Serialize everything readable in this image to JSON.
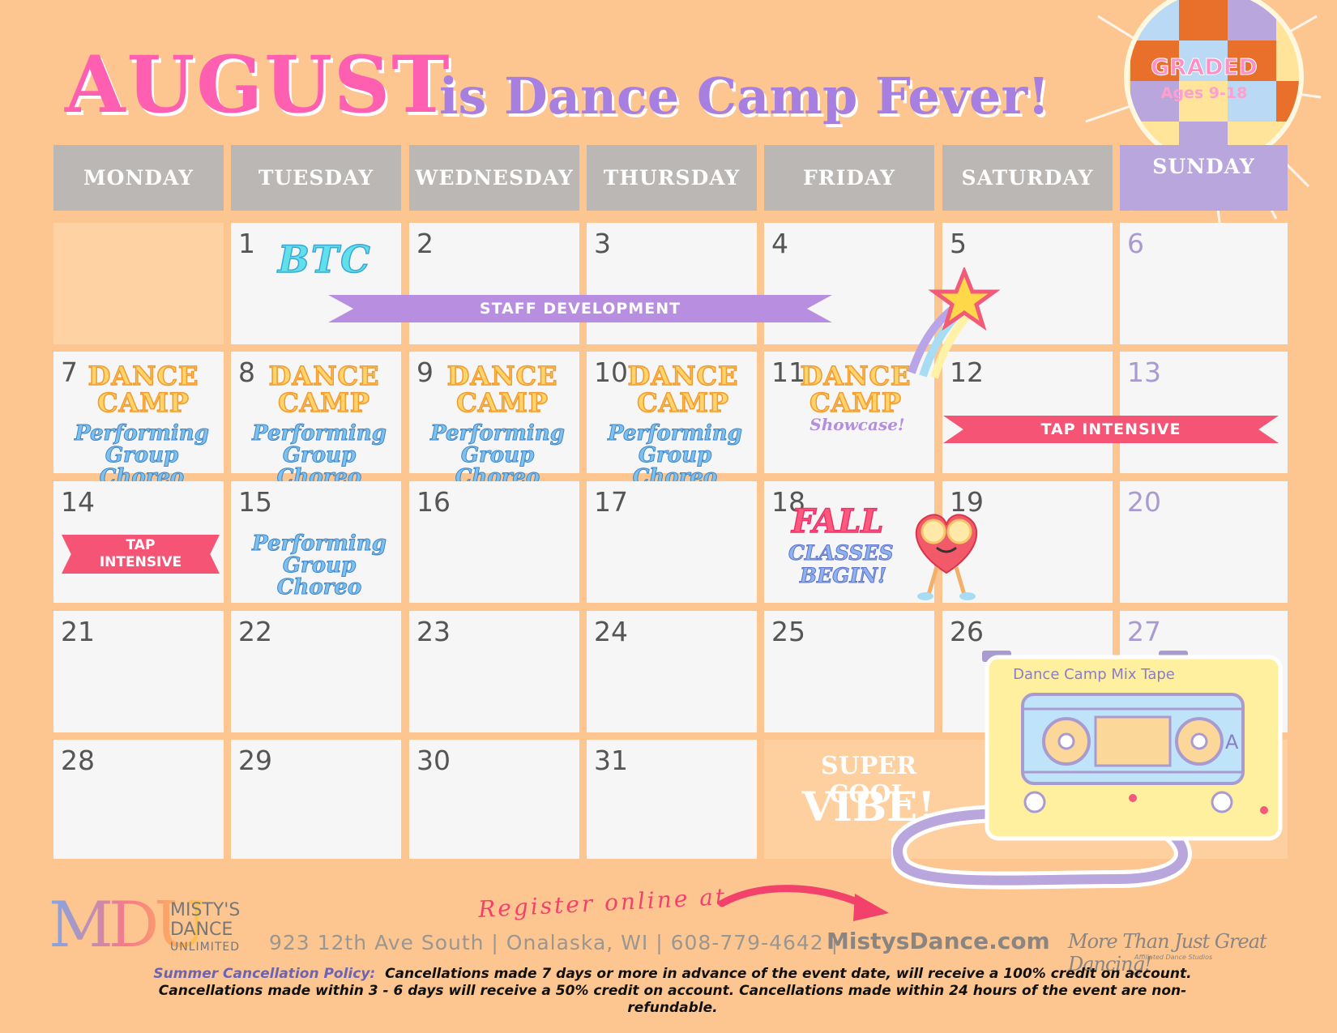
{
  "header": {
    "month": "AUGUST",
    "subtitle": "is Dance Camp Fever!",
    "badge_title": "GRADED",
    "badge_ages": "Ages 9-18"
  },
  "days": [
    "MONDAY",
    "TUESDAY",
    "WEDNESDAY",
    "THURSDAY",
    "FRIDAY",
    "SATURDAY",
    "SUNDAY"
  ],
  "dates": {
    "d1": "1",
    "d2": "2",
    "d3": "3",
    "d4": "4",
    "d5": "5",
    "d6": "6",
    "d7": "7",
    "d8": "8",
    "d9": "9",
    "d10": "10",
    "d11": "11",
    "d12": "12",
    "d13": "13",
    "d14": "14",
    "d15": "15",
    "d16": "16",
    "d17": "17",
    "d18": "18",
    "d19": "19",
    "d20": "20",
    "d21": "21",
    "d22": "22",
    "d23": "23",
    "d24": "24",
    "d25": "25",
    "d26": "26",
    "d27": "27",
    "d28": "28",
    "d29": "29",
    "d30": "30",
    "d31": "31"
  },
  "events": {
    "btc": "BTC",
    "staff_development": "STAFF DEVELOPMENT",
    "dance": "DANCE",
    "camp": "CAMP",
    "performing": "Performing",
    "group_choreo": "Group Choreo",
    "showcase": "Showcase!",
    "tap_intensive": "TAP INTENSIVE",
    "tap": "TAP",
    "intensive": "INTENSIVE",
    "fall": "FALL",
    "classes": "CLASSES",
    "begin": "BEGIN!",
    "super_cool": "SUPER COOL",
    "vibe": "VIBE!",
    "mix_tape": "Dance Camp Mix Tape",
    "tape_side": "A"
  },
  "footer": {
    "register": "Register online at",
    "logo_letters": "MDU",
    "logo_line1": "MISTY'S",
    "logo_line2": "DANCE",
    "logo_line3": "UNLIMITED",
    "address": "923 12th Ave South  |  Onalaska, WI  |  608-779-4642  |",
    "website": "MistysDance.com",
    "tagline": "More Than Just Great Dancing!",
    "tagline_small": "Affiliated Dance Studios",
    "policy_label": "Summer Cancellation Policy:",
    "policy_line1": "Cancellations made 7 days or more in advance of the event date, will receive a 100% credit on account.",
    "policy_line2": "Cancellations made within 3 - 6 days will receive a 50% credit on account. Cancellations made within 24 hours of the event are non-refundable."
  },
  "colors": {
    "background": "#fdc691",
    "header_gray": "#bbb7b4",
    "sunday_purple": "#b9a6dd",
    "title_pink": "#ff5fb0",
    "subtitle_purple": "#a77fe0",
    "staff_banner": "#b88fe0",
    "tap_banner": "#f55474"
  },
  "icons": [
    "disco-ball-icon",
    "shooting-star-icon",
    "heart-character-icon",
    "cassette-tape-icon",
    "arrow-icon"
  ]
}
